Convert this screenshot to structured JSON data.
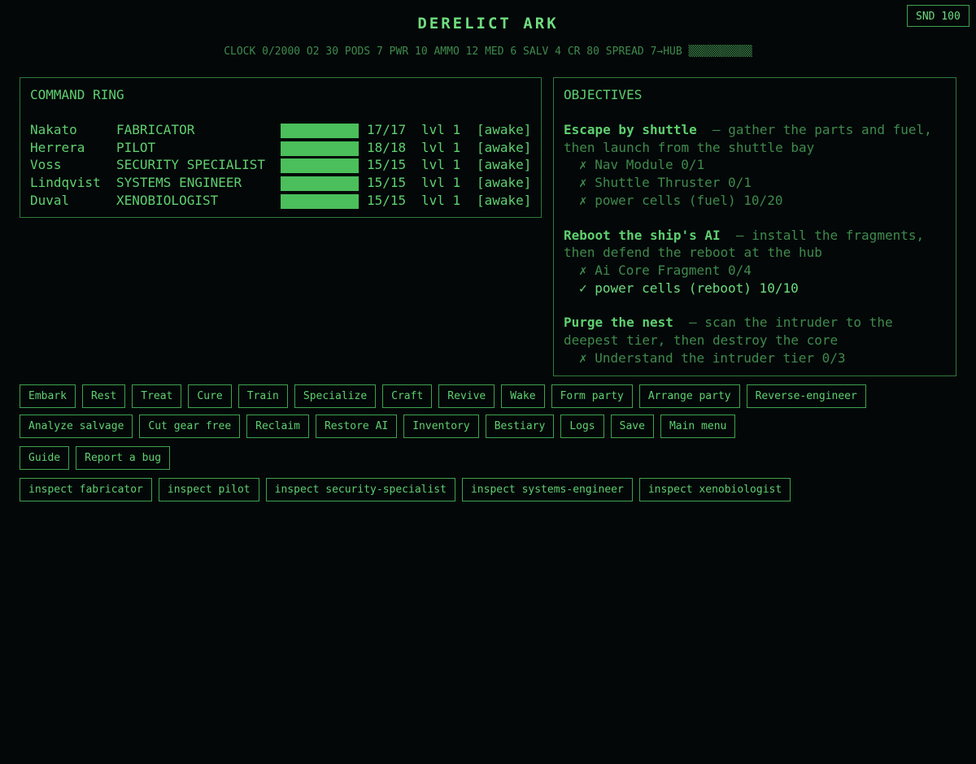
{
  "sound_label": "SND 100",
  "title": "DERELICT ARK",
  "status_line": "CLOCK 0/2000 O2 30 PODS 7 PWR 10 AMMO 12 MED 6 SALV 4 CR 80 SPREAD 7→HUB ▒▒▒▒▒▒▒▒▒▒",
  "command": {
    "title": "COMMAND RING",
    "crew": [
      {
        "name": "Nakato",
        "role": "FABRICATOR",
        "hp_bar": "██████████",
        "hp": "17/17",
        "level": "lvl 1",
        "state": "[awake]",
        "hp_fraction": 1.0
      },
      {
        "name": "Herrera",
        "role": "PILOT",
        "hp_bar": "██████████",
        "hp": "18/18",
        "level": "lvl 1",
        "state": "[awake]",
        "hp_fraction": 1.0
      },
      {
        "name": "Voss",
        "role": "SECURITY SPECIALIST",
        "hp_bar": "██████████",
        "hp": "15/15",
        "level": "lvl 1",
        "state": "[awake]",
        "hp_fraction": 1.0
      },
      {
        "name": "Lindqvist",
        "role": "SYSTEMS ENGINEER",
        "hp_bar": "██████████",
        "hp": "15/15",
        "level": "lvl 1",
        "state": "[awake]",
        "hp_fraction": 1.0
      },
      {
        "name": "Duval",
        "role": "XENOBIOLOGIST",
        "hp_bar": "██████████",
        "hp": "15/15",
        "level": "lvl 1",
        "state": "[awake]",
        "hp_fraction": 1.0
      }
    ]
  },
  "objectives": {
    "title": "OBJECTIVES",
    "items": [
      {
        "name": "Escape by shuttle",
        "desc": "  — gather the parts and fuel, then launch from the shuttle bay",
        "reqs": [
          {
            "text": "✗ Nav Module 0/1",
            "done": false
          },
          {
            "text": "✗ Shuttle Thruster 0/1",
            "done": false
          },
          {
            "text": "✗ power cells (fuel) 10/20",
            "done": false
          }
        ]
      },
      {
        "name": "Reboot the ship's AI",
        "desc": "  — install the fragments, then defend the reboot at the hub",
        "reqs": [
          {
            "text": "✗ Ai Core Fragment 0/4",
            "done": false
          },
          {
            "text": "✓ power cells (reboot) 10/10",
            "done": true
          }
        ]
      },
      {
        "name": "Purge the nest",
        "desc": "  — scan the intruder to the deepest tier, then destroy the core",
        "reqs": [
          {
            "text": "✗ Understand the intruder tier 0/3",
            "done": false
          }
        ]
      }
    ]
  },
  "actions_row1": [
    "Embark",
    "Rest",
    "Treat",
    "Cure",
    "Train",
    "Specialize",
    "Craft",
    "Revive",
    "Wake",
    "Form party",
    "Arrange party",
    "Reverse-engineer"
  ],
  "actions_row2": [
    "Analyze salvage",
    "Cut gear free",
    "Reclaim",
    "Restore AI",
    "Inventory",
    "Bestiary",
    "Logs",
    "Save",
    "Main menu"
  ],
  "actions_row3": [
    "Guide",
    "Report a bug"
  ],
  "inspect_row": [
    "inspect fabricator",
    "inspect pilot",
    "inspect security-specialist",
    "inspect systems-engineer",
    "inspect xenobiologist"
  ],
  "colors": {
    "background": "#030708",
    "accent": "#5fcf6f",
    "dim": "#3f8a4c",
    "border": "#2f7a3a"
  }
}
